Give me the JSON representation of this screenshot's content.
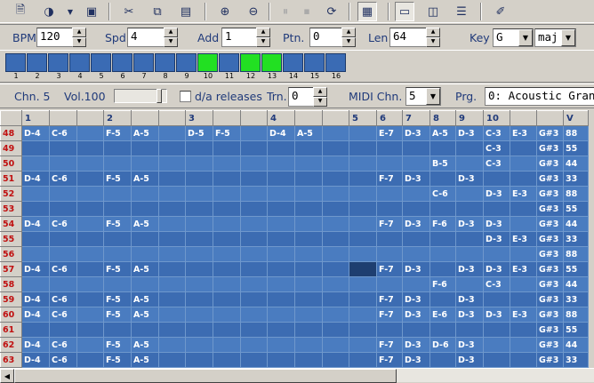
{
  "toolbar": {
    "icons": [
      "new-file-icon",
      "open-icon",
      "dropdown-icon",
      "save-icon",
      "cut-icon",
      "copy-icon",
      "paste-icon",
      "zoom-in-icon",
      "zoom-out-icon",
      "pause-icon",
      "stop-icon",
      "loop-icon",
      "piano-icon",
      "window-icon",
      "find-icon",
      "list-icon",
      "settings-icon"
    ]
  },
  "controls": {
    "bpm_label": "BPM",
    "bpm_value": "120",
    "spd_label": "Spd",
    "spd_value": "4",
    "add_label": "Add",
    "add_value": "1",
    "ptn_label": "Ptn.",
    "ptn_value": "0",
    "len_label": "Len",
    "len_value": "64",
    "key_label": "Key",
    "key_value": "G",
    "mode_value": "maj"
  },
  "pads": {
    "count": 16,
    "active": [
      10,
      12,
      13
    ],
    "labels": [
      "1",
      "2",
      "3",
      "4",
      "5",
      "6",
      "7",
      "8",
      "9",
      "10",
      "11",
      "12",
      "13",
      "14",
      "15",
      "16"
    ]
  },
  "channel": {
    "chn_label": "Chn. 5",
    "vol_label": "Vol.100",
    "vol_level": 0.9,
    "da_label": "d/a releases",
    "da_checked": false,
    "trn_label": "Trn.",
    "trn_value": "0",
    "midi_label": "MIDI Chn.",
    "midi_value": "5",
    "prg_label": "Prg.",
    "prg_value": "0: Acoustic Grand P"
  },
  "grid": {
    "headers": [
      "",
      "1",
      "",
      "",
      "2",
      "",
      "",
      "3",
      "",
      "",
      "4",
      "",
      "",
      "5",
      "6",
      "7",
      "8",
      "9",
      "10",
      "",
      "",
      "V"
    ],
    "rows": [
      [
        "48",
        "D-4",
        "C-6",
        "",
        "F-5",
        "A-5",
        "",
        "D-5",
        "F-5",
        "",
        "D-4",
        "A-5",
        "",
        "",
        "E-7",
        "D-3",
        "A-5",
        "D-3",
        "C-3",
        "E-3",
        "G#3",
        "88"
      ],
      [
        "49",
        "",
        "",
        "",
        "",
        "",
        "",
        "",
        "",
        "",
        "",
        "",
        "",
        "",
        "",
        "",
        "",
        "",
        "C-3",
        "",
        "G#3",
        "55"
      ],
      [
        "50",
        "",
        "",
        "",
        "",
        "",
        "",
        "",
        "",
        "",
        "",
        "",
        "",
        "",
        "",
        "",
        "B-5",
        "",
        "C-3",
        "",
        "G#3",
        "44"
      ],
      [
        "51",
        "D-4",
        "C-6",
        "",
        "F-5",
        "A-5",
        "",
        "",
        "",
        "",
        "",
        "",
        "",
        "",
        "F-7",
        "D-3",
        "",
        "D-3",
        "",
        "",
        "G#3",
        "33"
      ],
      [
        "52",
        "",
        "",
        "",
        "",
        "",
        "",
        "",
        "",
        "",
        "",
        "",
        "",
        "",
        "",
        "",
        "C-6",
        "",
        "D-3",
        "E-3",
        "G#3",
        "88"
      ],
      [
        "53",
        "",
        "",
        "",
        "",
        "",
        "",
        "",
        "",
        "",
        "",
        "",
        "",
        "",
        "",
        "",
        "",
        "",
        "",
        "",
        "G#3",
        "55"
      ],
      [
        "54",
        "D-4",
        "C-6",
        "",
        "F-5",
        "A-5",
        "",
        "",
        "",
        "",
        "",
        "",
        "",
        "",
        "F-7",
        "D-3",
        "F-6",
        "D-3",
        "D-3",
        "",
        "G#3",
        "44"
      ],
      [
        "55",
        "",
        "",
        "",
        "",
        "",
        "",
        "",
        "",
        "",
        "",
        "",
        "",
        "",
        "",
        "",
        "",
        "",
        "D-3",
        "E-3",
        "G#3",
        "33"
      ],
      [
        "56",
        "",
        "",
        "",
        "",
        "",
        "",
        "",
        "",
        "",
        "",
        "",
        "",
        "",
        "",
        "",
        "",
        "",
        "",
        "",
        "G#3",
        "88"
      ],
      [
        "57",
        "D-4",
        "C-6",
        "",
        "F-5",
        "A-5",
        "",
        "",
        "",
        "",
        "",
        "",
        "",
        "",
        "F-7",
        "D-3",
        "",
        "D-3",
        "D-3",
        "E-3",
        "G#3",
        "55"
      ],
      [
        "58",
        "",
        "",
        "",
        "",
        "",
        "",
        "",
        "",
        "",
        "",
        "",
        "",
        "",
        "",
        "",
        "F-6",
        "",
        "C-3",
        "",
        "G#3",
        "44"
      ],
      [
        "59",
        "D-4",
        "C-6",
        "",
        "F-5",
        "A-5",
        "",
        "",
        "",
        "",
        "",
        "",
        "",
        "",
        "F-7",
        "D-3",
        "",
        "D-3",
        "",
        "",
        "G#3",
        "33"
      ],
      [
        "60",
        "D-4",
        "C-6",
        "",
        "F-5",
        "A-5",
        "",
        "",
        "",
        "",
        "",
        "",
        "",
        "",
        "F-7",
        "D-3",
        "E-6",
        "D-3",
        "D-3",
        "E-3",
        "G#3",
        "88"
      ],
      [
        "61",
        "",
        "",
        "",
        "",
        "",
        "",
        "",
        "",
        "",
        "",
        "",
        "",
        "",
        "",
        "",
        "",
        "",
        "",
        "",
        "G#3",
        "55"
      ],
      [
        "62",
        "D-4",
        "C-6",
        "",
        "F-5",
        "A-5",
        "",
        "",
        "",
        "",
        "",
        "",
        "",
        "",
        "F-7",
        "D-3",
        "D-6",
        "D-3",
        "",
        "",
        "G#3",
        "44"
      ],
      [
        "63",
        "D-4",
        "C-6",
        "",
        "F-5",
        "A-5",
        "",
        "",
        "",
        "",
        "",
        "",
        "",
        "",
        "F-7",
        "D-3",
        "",
        "D-3",
        "",
        "",
        "G#3",
        "33"
      ]
    ],
    "current_row": "57",
    "current_col": 13
  }
}
